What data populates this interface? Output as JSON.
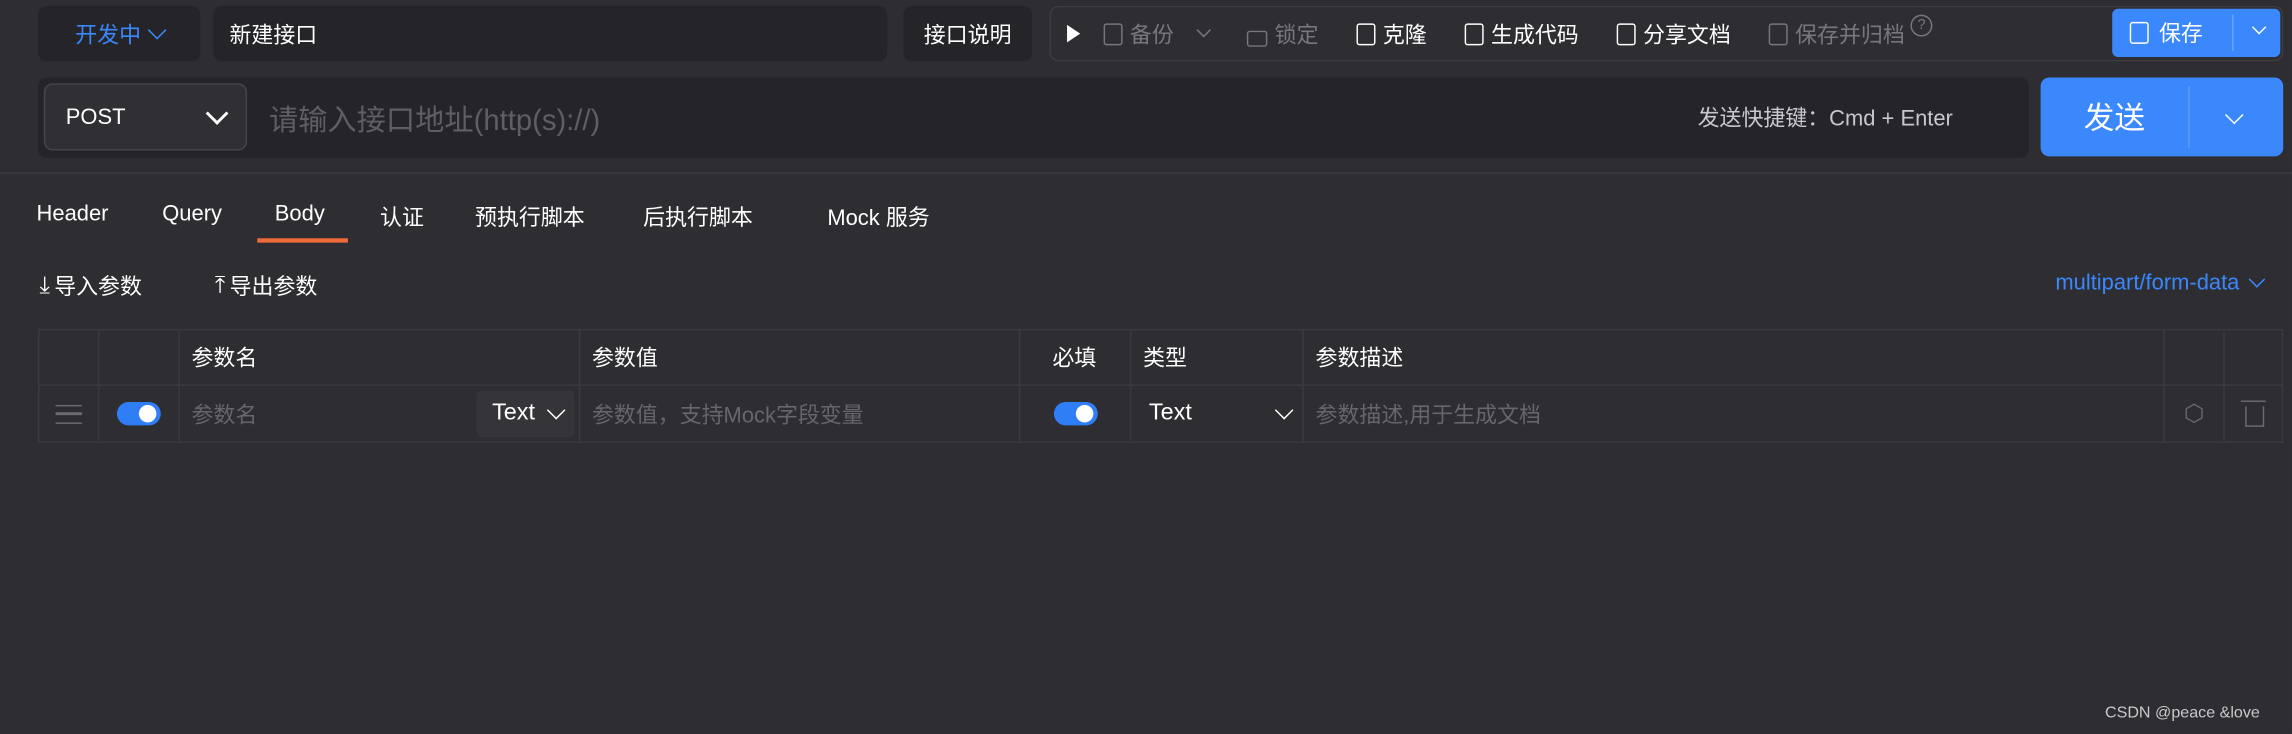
{
  "header": {
    "status": "开发中",
    "name_value": "新建接口",
    "doc_button": "接口说明",
    "toolbar": {
      "backup": "备份",
      "lock": "锁定",
      "clone": "克隆",
      "generate_code": "生成代码",
      "share_doc": "分享文档",
      "save_archive": "保存并归档",
      "save": "保存"
    },
    "colors": {
      "accent": "#3b88fd",
      "tab_underline": "#ee6a3a"
    }
  },
  "request": {
    "method": "POST",
    "url_placeholder": "请输入接口地址(http(s)://)",
    "shortcut_hint": "发送快捷键：Cmd + Enter",
    "send": "发送"
  },
  "tabs": [
    {
      "label": "Header"
    },
    {
      "label": "Query"
    },
    {
      "label": "Body",
      "active": true
    },
    {
      "label": "认证"
    },
    {
      "label": "预执行脚本"
    },
    {
      "label": "后执行脚本"
    },
    {
      "label": "Mock 服务"
    }
  ],
  "body": {
    "import": "导入参数",
    "export": "导出参数",
    "content_type": "multipart/form-data",
    "columns": [
      "参数名",
      "参数值",
      "必填",
      "类型",
      "参数描述"
    ],
    "row": {
      "enabled": true,
      "name_placeholder": "参数名",
      "name_type": "Text",
      "value_placeholder": "参数值，支持Mock字段变量",
      "required": true,
      "type": "Text",
      "desc_placeholder": "参数描述,用于生成文档"
    }
  },
  "watermark": "CSDN @peace &love"
}
